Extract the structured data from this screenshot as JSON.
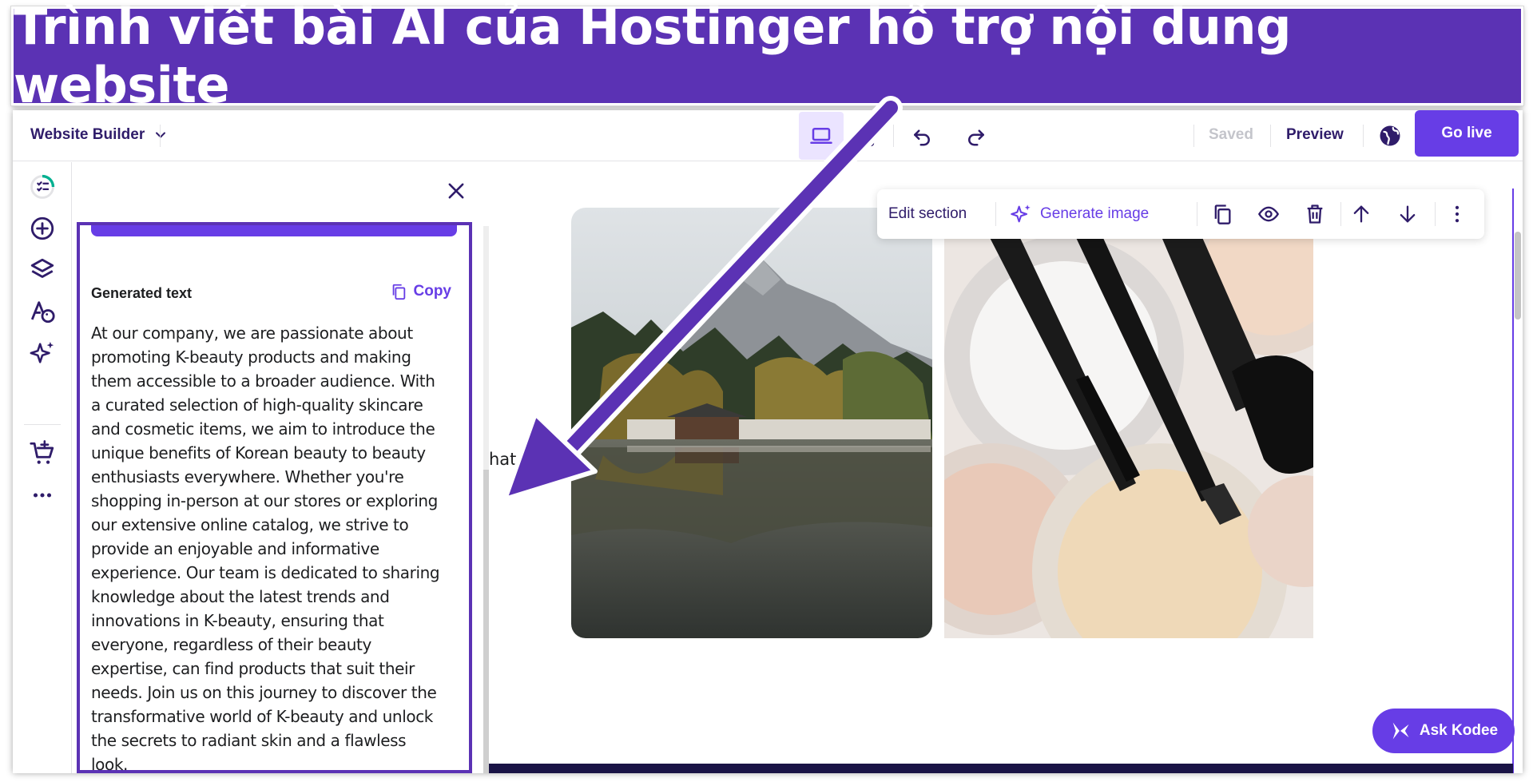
{
  "banner": {
    "title": "Trình viết bài AI của Hostinger hỗ trợ nội dung website"
  },
  "topbar": {
    "app_title": "Website Builder",
    "saved_label": "Saved",
    "preview_label": "Preview",
    "go_live_label": "Go live"
  },
  "panel": {
    "generated_label": "Generated text",
    "copy_label": "Copy",
    "generated_text": "At our company, we are passionate about promoting K-beauty products and making them accessible to a broader audience. With a curated selection of high-quality skincare and cosmetic items, we aim to introduce the unique benefits of Korean beauty to beauty enthusiasts everywhere. Whether you're shopping in-person at our stores or exploring our extensive online catalog, we strive to provide an enjoyable and informative experience. Our team is dedicated to sharing knowledge about the latest trends and innovations in K-beauty, ensuring that everyone, regardless of their beauty expertise, can find products that suit their needs. Join us on this journey to discover the transformative world of K-beauty and unlock the secrets to radiant skin and a flawless look."
  },
  "canvas": {
    "partial_text": "hat"
  },
  "section_toolbar": {
    "edit_label": "Edit section",
    "generate_image_label": "Generate image"
  },
  "kodee": {
    "label": "Ask Kodee"
  },
  "colors": {
    "brand": "#673de6",
    "banner": "#5b32b4",
    "dark_text": "#2f1c6a"
  }
}
